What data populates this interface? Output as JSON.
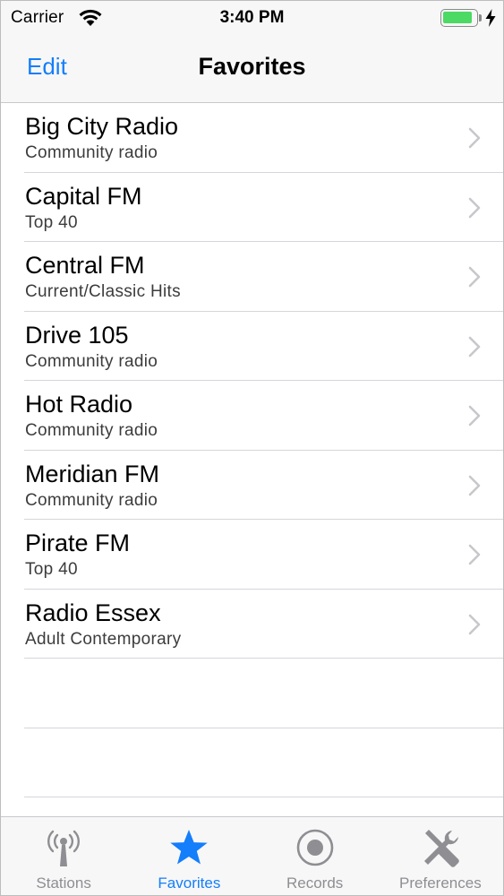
{
  "status_bar": {
    "carrier": "Carrier",
    "time": "3:40 PM",
    "battery_level": 0.9,
    "battery_color": "#4cd964"
  },
  "nav_bar": {
    "edit_label": "Edit",
    "title": "Favorites"
  },
  "stations": [
    {
      "name": "Big City Radio",
      "genre": "Community radio"
    },
    {
      "name": "Capital FM",
      "genre": "Top 40"
    },
    {
      "name": "Central FM",
      "genre": "Current/Classic Hits"
    },
    {
      "name": "Drive 105",
      "genre": "Community radio"
    },
    {
      "name": "Hot Radio",
      "genre": "Community radio"
    },
    {
      "name": "Meridian FM",
      "genre": "Community radio"
    },
    {
      "name": "Pirate FM",
      "genre": "Top 40"
    },
    {
      "name": "Radio Essex",
      "genre": "Adult Contemporary"
    }
  ],
  "tab_bar": {
    "tabs": [
      {
        "label": "Stations",
        "icon": "antenna-icon",
        "active": false
      },
      {
        "label": "Favorites",
        "icon": "star-icon",
        "active": true
      },
      {
        "label": "Records",
        "icon": "record-icon",
        "active": false
      },
      {
        "label": "Preferences",
        "icon": "tools-icon",
        "active": false
      }
    ]
  },
  "colors": {
    "accent": "#147efb",
    "inactive": "#8e8e93"
  }
}
